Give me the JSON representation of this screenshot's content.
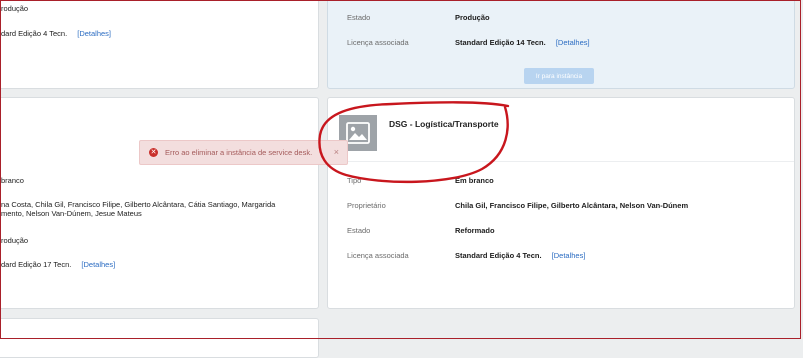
{
  "top_left_card": {
    "state_value": "rodução",
    "license_value": "dard Edição 4 Tecn.",
    "details_link": "[Detalhes]"
  },
  "top_right_card": {
    "state_label": "Estado",
    "state_value": "Produção",
    "license_label": "Licença associada",
    "license_value": "Standard Edição 14 Tecn.",
    "details_link": "[Detalhes]",
    "go_button": "Ir para instância"
  },
  "mid_left_card": {
    "type_value": "branco",
    "owners_line1": "na Costa, Chila Gil, Francisco Filipe, Gilberto Alcântara, Cátia Santiago, Margarida",
    "owners_line2": "mento, Nelson Van-Dúnem, Jesue Mateus",
    "state_value": "rodução",
    "license_value": "dard Edição 17 Tecn.",
    "details_link": "[Detalhes]"
  },
  "dsg_card": {
    "title": "DSG - Logística/Transporte",
    "type_label": "Tipo",
    "type_value": "Em branco",
    "owner_label": "Proprietário",
    "owner_value": "Chila Gil, Francisco Filipe, Gilberto Alcântara, Nelson Van-Dúnem",
    "state_label": "Estado",
    "state_value": "Reformado",
    "license_label": "Licença associada",
    "license_value": "Standard Edição 4 Tecn.",
    "details_link": "[Detalhes]"
  },
  "error_toast": {
    "message": "Erro ao eliminar a instância de service desk.",
    "close_glyph": "×"
  },
  "colors": {
    "annotation_red": "#c8161d",
    "error_icon": "#c9302c",
    "link": "#2b6cc2"
  }
}
